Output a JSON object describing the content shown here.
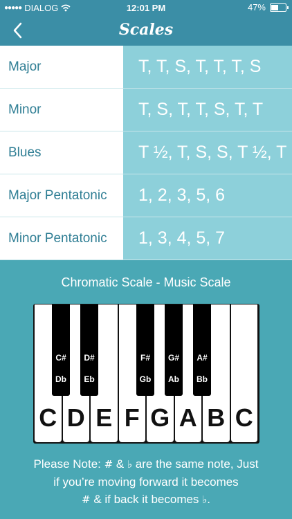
{
  "status": {
    "carrier": "DIALOG",
    "time": "12:01 PM",
    "battery": "47%",
    "signal_dots": "●●●●●"
  },
  "nav": {
    "title": "Scales",
    "back_icon": "chevron-left-icon"
  },
  "scales": [
    {
      "name": "Major",
      "pattern": "T, T, S, T, T, T, S"
    },
    {
      "name": "Minor",
      "pattern": "T, S, T, T, S, T, T"
    },
    {
      "name": "Blues",
      "pattern": "T ½, T, S, S, T ½, T"
    },
    {
      "name": "Major Pentatonic",
      "pattern": "1, 2, 3, 5, 6"
    },
    {
      "name": "Minor Pentatonic",
      "pattern": "1, 3, 4, 5, 7"
    }
  ],
  "chromatic_title": "Chromatic Scale - Music Scale",
  "keys": {
    "white": [
      "C",
      "D",
      "E",
      "F",
      "G",
      "A",
      "B",
      "C"
    ],
    "black": [
      {
        "sharp": "C#",
        "flat": "Db"
      },
      {
        "sharp": "D#",
        "flat": "Eb"
      },
      {
        "sharp": "F#",
        "flat": "Gb"
      },
      {
        "sharp": "G#",
        "flat": "Ab"
      },
      {
        "sharp": "A#",
        "flat": "Bb"
      }
    ]
  },
  "note": {
    "part1": "Please Note: ",
    "sharp": "#",
    "amp": " & ",
    "flat": "♭",
    "part2": " are the same note, Just",
    "line2": "if you’re moving forward it becomes",
    "line3_mid": " & if back it becomes ",
    "line3_end": "."
  },
  "colors": {
    "header": "#3b8ea6",
    "background": "#4aa8b5",
    "pattern_cell": "#8dd0da",
    "name_text": "#2f7e94"
  }
}
